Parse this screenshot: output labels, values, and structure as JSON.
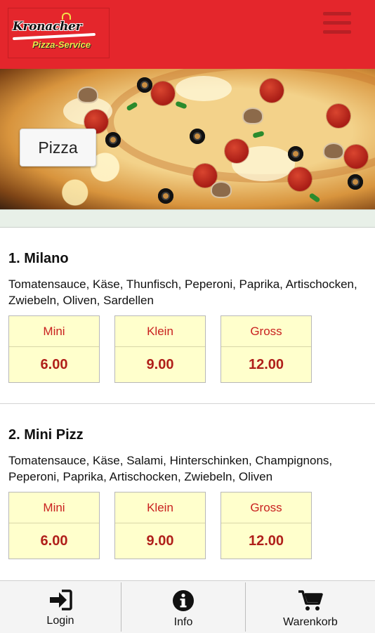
{
  "header": {
    "logo_title": "Kronacher",
    "logo_subtitle": "Pizza-Service",
    "menu_icon": "hamburger-menu-icon",
    "background_color": "#e4262c"
  },
  "hero": {
    "category_label": "Pizza"
  },
  "menu": {
    "items": [
      {
        "title": "1. Milano",
        "description": "Tomatensauce, Käse, Thunfisch, Peperoni, Paprika, Artischocken, Zwiebeln, Oliven, Sardellen",
        "prices": [
          {
            "size": "Mini",
            "price": "6.00"
          },
          {
            "size": "Klein",
            "price": "9.00"
          },
          {
            "size": "Gross",
            "price": "12.00"
          }
        ]
      },
      {
        "title": "2. Mini Pizz",
        "description": "Tomatensauce, Käse, Salami, Hinterschinken, Champignons, Peperoni, Paprika, Artischocken, Zwiebeln, Oliven",
        "prices": [
          {
            "size": "Mini",
            "price": "6.00"
          },
          {
            "size": "Klein",
            "price": "9.00"
          },
          {
            "size": "Gross",
            "price": "12.00"
          }
        ]
      }
    ]
  },
  "footer": {
    "buttons": [
      {
        "label": "Login",
        "icon": "login-icon"
      },
      {
        "label": "Info",
        "icon": "info-icon"
      },
      {
        "label": "Warenkorb",
        "icon": "shopping-cart-icon"
      }
    ]
  },
  "colors": {
    "price_card_bg": "#ffffcc",
    "price_text": "#b01f1a"
  }
}
